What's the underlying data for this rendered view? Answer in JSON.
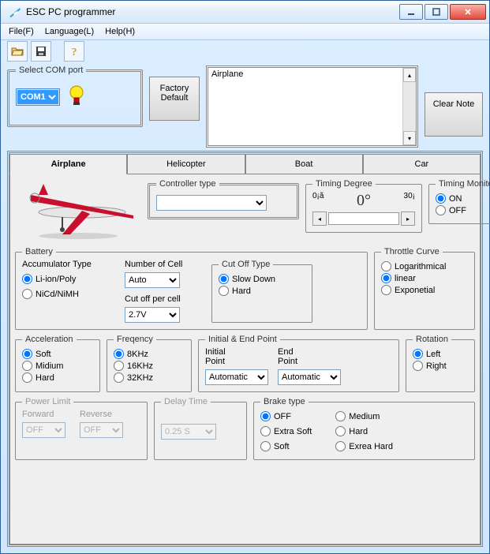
{
  "window": {
    "title": "ESC PC programmer"
  },
  "menu": {
    "file": "File(F)",
    "language": "Language(L)",
    "help": "Help(H)"
  },
  "comport": {
    "legend": "Select COM port",
    "value": "COM1"
  },
  "factory_default": "Factory\nDefault",
  "note": {
    "text": "Airplane",
    "clear": "Clear Note"
  },
  "tabs": {
    "airplane": "Airplane",
    "helicopter": "Helicopter",
    "boat": "Boat",
    "car": "Car"
  },
  "controller": {
    "legend": "Controller type",
    "value": ""
  },
  "timing": {
    "legend": "Timing Degree",
    "min": "0¡ã",
    "max": "30¡",
    "value": "0°"
  },
  "tmon": {
    "legend": "Timing Monitor",
    "on": "ON",
    "off": "OFF",
    "selected": "on"
  },
  "battery": {
    "legend": "Battery",
    "accum": {
      "legend": "Accumulator Type",
      "li": "Li-ion/Poly",
      "ni": "NiCd/NiMH",
      "selected": "li"
    },
    "cells": {
      "legend": "Number of Cell",
      "value": "Auto"
    },
    "cutoffper": {
      "legend": "Cut off per cell",
      "value": "2.7V"
    },
    "cutofftype": {
      "legend": "Cut Off Type",
      "slow": "Slow Down",
      "hard": "Hard",
      "selected": "slow"
    }
  },
  "throttle": {
    "legend": "Throttle Curve",
    "log": "Logarithmical",
    "lin": "linear",
    "exp": "Exponetial",
    "selected": "lin"
  },
  "accel": {
    "legend": "Acceleration",
    "soft": "Soft",
    "mid": "Midium",
    "hard": "Hard",
    "selected": "soft"
  },
  "freq": {
    "legend": "Freqency",
    "k8": "8KHz",
    "k16": "16KHz",
    "k32": "32KHz",
    "selected": "k8"
  },
  "initend": {
    "legend": "Initial & End Point",
    "init_lbl": "Initial\nPoint",
    "end_lbl": "End\nPoint",
    "init": "Automatic",
    "end": "Automatic"
  },
  "rotation": {
    "legend": "Rotation",
    "left": "Left",
    "right": "Right",
    "selected": "left"
  },
  "power": {
    "legend": "Power Limit",
    "fwd_lbl": "Forward",
    "rev_lbl": "Reverse",
    "fwd": "OFF",
    "rev": "OFF"
  },
  "delay": {
    "legend": "Delay Time",
    "value": "0.25 S"
  },
  "brake": {
    "legend": "Brake type",
    "off": "OFF",
    "extra_soft": "Extra Soft",
    "soft": "Soft",
    "medium": "Medium",
    "hard": "Hard",
    "exrea_hard": "Exrea Hard",
    "selected": "off"
  }
}
